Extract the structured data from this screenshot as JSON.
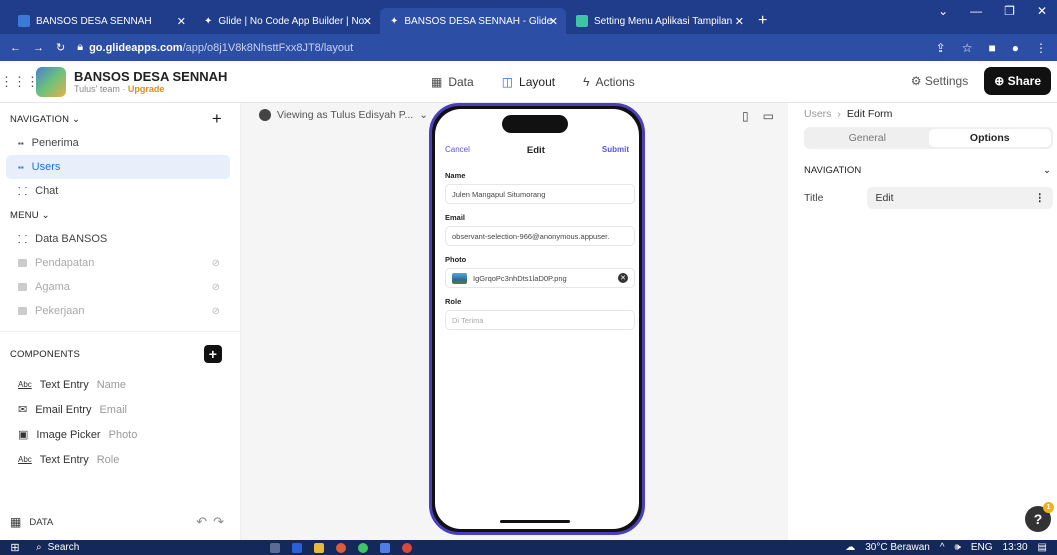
{
  "browser": {
    "tabs": [
      {
        "label": "BANSOS DESA SENNAH",
        "color": "#3b7bd6",
        "active": false
      },
      {
        "label": "Glide | No Code App Builder | No",
        "color": "#ffffff",
        "active": false
      },
      {
        "label": "BANSOS DESA SENNAH - Glide",
        "color": "#ffffff",
        "active": true
      },
      {
        "label": "Setting Menu Aplikasi Tampilan",
        "color": "#3ec5a3",
        "active": false
      }
    ],
    "url_host": "go.glideapps.com",
    "url_path": "/app/o8j1V8k8NhsttFxx8JT8/layout"
  },
  "app": {
    "title": "BANSOS DESA SENNAH",
    "team": "Tulus' team · ",
    "upgrade": "Upgrade",
    "nav": {
      "data": "Data",
      "layout": "Layout",
      "actions": "Actions"
    },
    "settings": "Settings",
    "share": "Share"
  },
  "left": {
    "navigation_header": "NAVIGATION",
    "nav_items": [
      {
        "label": "Penerima"
      },
      {
        "label": "Users"
      },
      {
        "label": "Chat"
      }
    ],
    "menu_header": "MENU",
    "menu_items": [
      {
        "label": "Data BANSOS"
      },
      {
        "label": "Pendapatan"
      },
      {
        "label": "Agama"
      },
      {
        "label": "Pekerjaan"
      }
    ],
    "components_header": "COMPONENTS",
    "components": [
      {
        "type": "Text Entry",
        "sub": "Name"
      },
      {
        "type": "Email Entry",
        "sub": "Email"
      },
      {
        "type": "Image Picker",
        "sub": "Photo"
      },
      {
        "type": "Text Entry",
        "sub": "Role"
      }
    ],
    "data_footer": "DATA"
  },
  "canvas": {
    "viewing_as": "Viewing as Tulus Edisyah P...",
    "form": {
      "cancel": "Cancel",
      "title": "Edit",
      "submit": "Submit",
      "name_label": "Name",
      "name_value": "Julen Mangapul Situmorang",
      "email_label": "Email",
      "email_value": "observant-selection-966@anonymous.appuser.",
      "photo_label": "Photo",
      "photo_value": "IgGrqoPc3nhDts1laD0P.png",
      "role_label": "Role",
      "role_placeholder": "Di Terima"
    }
  },
  "right": {
    "crumb_parent": "Users",
    "crumb_current": "Edit Form",
    "tab_general": "General",
    "tab_options": "Options",
    "section": "NAVIGATION",
    "title_label": "Title",
    "title_value": "Edit"
  },
  "taskbar": {
    "search": "Search",
    "weather": "30°C Berawan",
    "lang": "ENG",
    "time": "13:30"
  }
}
